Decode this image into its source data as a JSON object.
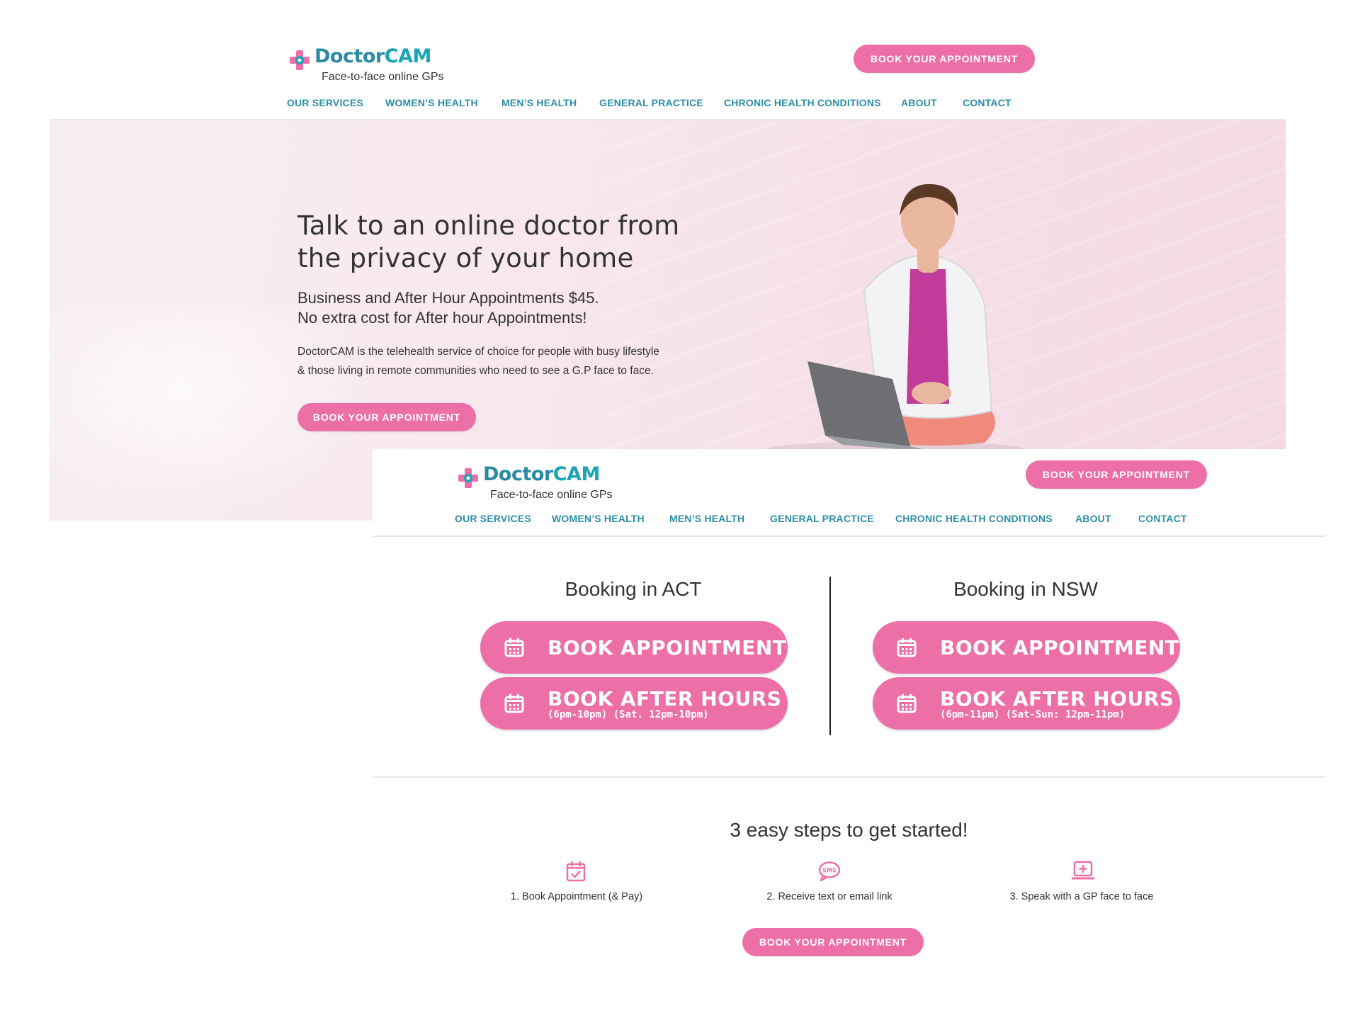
{
  "brand": {
    "name_part1": "Doctor",
    "name_part2": "CAM",
    "tagline": "Face-to-face online GPs"
  },
  "header": {
    "cta_label": "BOOK YOUR APPOINTMENT"
  },
  "nav": {
    "items": [
      {
        "label": "OUR SERVICES"
      },
      {
        "label": "WOMEN’S HEALTH"
      },
      {
        "label": "MEN’S HEALTH"
      },
      {
        "label": "GENERAL PRACTICE"
      },
      {
        "label": "CHRONIC HEALTH CONDITIONS"
      },
      {
        "label": "ABOUT"
      },
      {
        "label": "CONTACT"
      }
    ]
  },
  "hero": {
    "title_line1": "Talk to an online doctor from",
    "title_line2": "the privacy of your home",
    "subtitle_line1": "Business and After Hour Appointments $45.",
    "subtitle_line2": "No extra cost for After hour Appointments!",
    "desc_line1": "DoctorCAM is the telehealth service of choice for people with busy lifestyle",
    "desc_line2": "& those living in remote communities who need to see a G.P face to face.",
    "cta_label": "BOOK YOUR APPOINTMENT"
  },
  "booking": {
    "act": {
      "title": "Booking in ACT",
      "book_label": "BOOK APPOINTMENT",
      "after_label": "BOOK AFTER HOURS",
      "after_hours": "(6pm-10pm) (Sat. 12pm-10pm)"
    },
    "nsw": {
      "title": "Booking in NSW",
      "book_label": "BOOK APPOINTMENT",
      "after_label": "BOOK AFTER HOURS",
      "after_hours": "(6pm-11pm) (Sat-Sun: 12pm-11pm)"
    }
  },
  "steps": {
    "title": "3 easy steps to get started!",
    "items": [
      {
        "label": "1. Book Appointment (& Pay)",
        "icon": "calendar-check-icon"
      },
      {
        "label": "2. Receive text or email link",
        "icon": "sms-bubble-icon"
      },
      {
        "label": "3. Speak with a GP face to face",
        "icon": "laptop-medical-icon"
      }
    ],
    "cta_label": "BOOK YOUR APPOINTMENT"
  },
  "colors": {
    "accent_pink": "#ec6fa8",
    "brand_teal": "#2b8ea8",
    "text": "#333333"
  }
}
